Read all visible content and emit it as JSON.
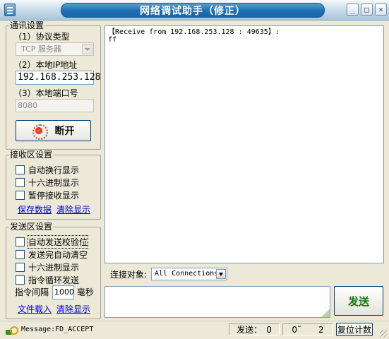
{
  "window": {
    "title": "网络调试助手（修正）",
    "buttons": {
      "minimize": "_",
      "maximize": "□",
      "close": "×"
    }
  },
  "comm": {
    "title": "通讯设置",
    "protocol_label": "（1）协议类型",
    "protocol_value": "TCP 服务器",
    "ip_label": "（2）本地IP地址",
    "ip_value": "192.168.253.128",
    "port_label": "（3）本地端口号",
    "port_value": "8080",
    "connect_button": "断开"
  },
  "recv": {
    "title": "接收区设置",
    "options": [
      "自动换行显示",
      "十六进制显示",
      "暂停接收显示"
    ],
    "links": [
      "保存数据",
      "清除显示"
    ],
    "text": "【Receive from 192.168.253.128 : 49635】:\nff"
  },
  "send": {
    "title": "发送区设置",
    "options": [
      "自动发送校验位",
      "发送完自动清空",
      "十六进制显示",
      "指令循环发送"
    ],
    "interval_label": "指令间隔",
    "interval_value": "1000",
    "interval_unit": "毫秒",
    "links": [
      "文件载入",
      "清除显示"
    ],
    "target_label": "连接对象:",
    "target_value": "All Connections",
    "send_button": "发送"
  },
  "status": {
    "message": "Message:FD_ACCEPT",
    "sent_label": "发送：",
    "sent_count": "0",
    "recv_prefix": "0˜",
    "recv_count": "2",
    "reset_button": "复位计数"
  }
}
